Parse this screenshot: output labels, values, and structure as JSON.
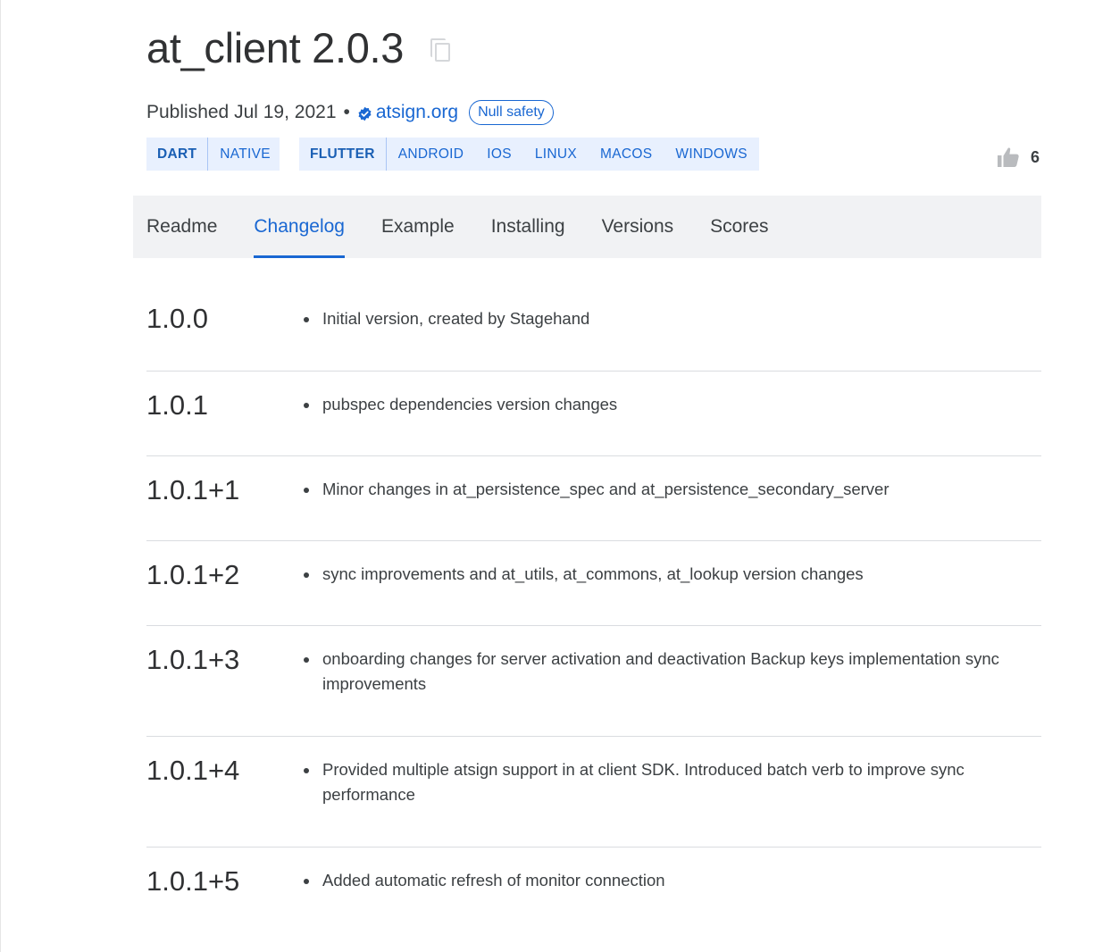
{
  "package": {
    "title": "at_client 2.0.3",
    "published_label": "Published Jul 19, 2021",
    "separator": "•",
    "publisher": "atsign.org",
    "null_safety_badge": "Null safety",
    "likes": "6"
  },
  "sdk_tags": [
    "DART",
    "NATIVE"
  ],
  "platform_tags": [
    "FLUTTER",
    "ANDROID",
    "IOS",
    "LINUX",
    "MACOS",
    "WINDOWS"
  ],
  "tabs": [
    {
      "label": "Readme",
      "active": false
    },
    {
      "label": "Changelog",
      "active": true
    },
    {
      "label": "Example",
      "active": false
    },
    {
      "label": "Installing",
      "active": false
    },
    {
      "label": "Versions",
      "active": false
    },
    {
      "label": "Scores",
      "active": false
    }
  ],
  "changelog": [
    {
      "version": "1.0.0",
      "notes": [
        "Initial version, created by Stagehand"
      ]
    },
    {
      "version": "1.0.1",
      "notes": [
        "pubspec dependencies version changes"
      ]
    },
    {
      "version": "1.0.1+1",
      "notes": [
        "Minor changes in at_persistence_spec and at_persistence_secondary_server"
      ]
    },
    {
      "version": "1.0.1+2",
      "notes": [
        "sync improvements and at_utils, at_commons, at_lookup version changes"
      ]
    },
    {
      "version": "1.0.1+3",
      "notes": [
        "onboarding changes for server activation and deactivation Backup keys implementation sync improvements"
      ]
    },
    {
      "version": "1.0.1+4",
      "notes": [
        "Provided multiple atsign support in at client SDK. Introduced batch verb to improve sync performance"
      ]
    },
    {
      "version": "1.0.1+5",
      "notes": [
        "Added automatic refresh of monitor connection"
      ]
    }
  ],
  "colors": {
    "link": "#1967d2",
    "tag_background": "#e8f0fe",
    "tabs_background": "#f1f2f4",
    "divider": "#dadce0"
  }
}
